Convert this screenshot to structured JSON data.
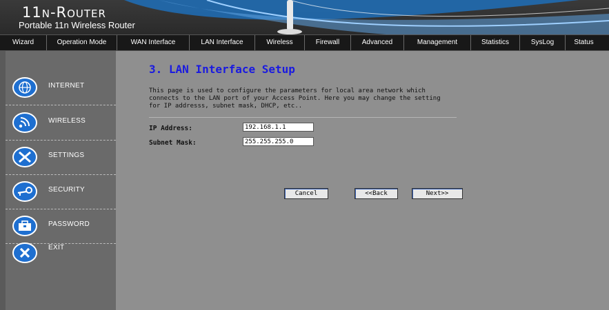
{
  "header": {
    "logo_title": "11n-Router",
    "logo_subtitle": "Portable 11n Wireless Router"
  },
  "nav": {
    "items": [
      {
        "label": "Wizard"
      },
      {
        "label": "Operation Mode"
      },
      {
        "label": "WAN Interface"
      },
      {
        "label": "LAN Interface"
      },
      {
        "label": "Wireless"
      },
      {
        "label": "Firewall"
      },
      {
        "label": "Advanced"
      },
      {
        "label": "Management"
      },
      {
        "label": "Statistics"
      },
      {
        "label": "SysLog"
      },
      {
        "label": "Status"
      }
    ]
  },
  "sidebar": {
    "items": [
      {
        "label": "INTERNET",
        "icon": "globe-icon"
      },
      {
        "label": "WIRELESS",
        "icon": "wireless-icon"
      },
      {
        "label": "SETTINGS",
        "icon": "tools-icon"
      },
      {
        "label": "SECURITY",
        "icon": "key-icon"
      },
      {
        "label": "PASSWORD",
        "icon": "toolbox-icon"
      },
      {
        "label": "EXIT",
        "icon": "close-icon"
      }
    ]
  },
  "main": {
    "title": "3. LAN Interface Setup",
    "description": "This page is used to configure the parameters for local area network which connects to the LAN port of your Access Point. Here you may change the setting for IP addresss, subnet mask, DHCP, etc..",
    "ip_label": "IP Address:",
    "ip_value": "192.168.1.1",
    "mask_label": "Subnet Mask:",
    "mask_value": "255.255.255.0",
    "cancel_label": "Cancel",
    "back_label": "<<Back",
    "next_label": "Next>>"
  },
  "colors": {
    "title_blue": "#1a1ae0",
    "nav_bg": "#181818",
    "sidebar_bg": "#6a6a6a",
    "main_bg": "#8f8f8f",
    "icon_blue": "#1e6fd0"
  }
}
